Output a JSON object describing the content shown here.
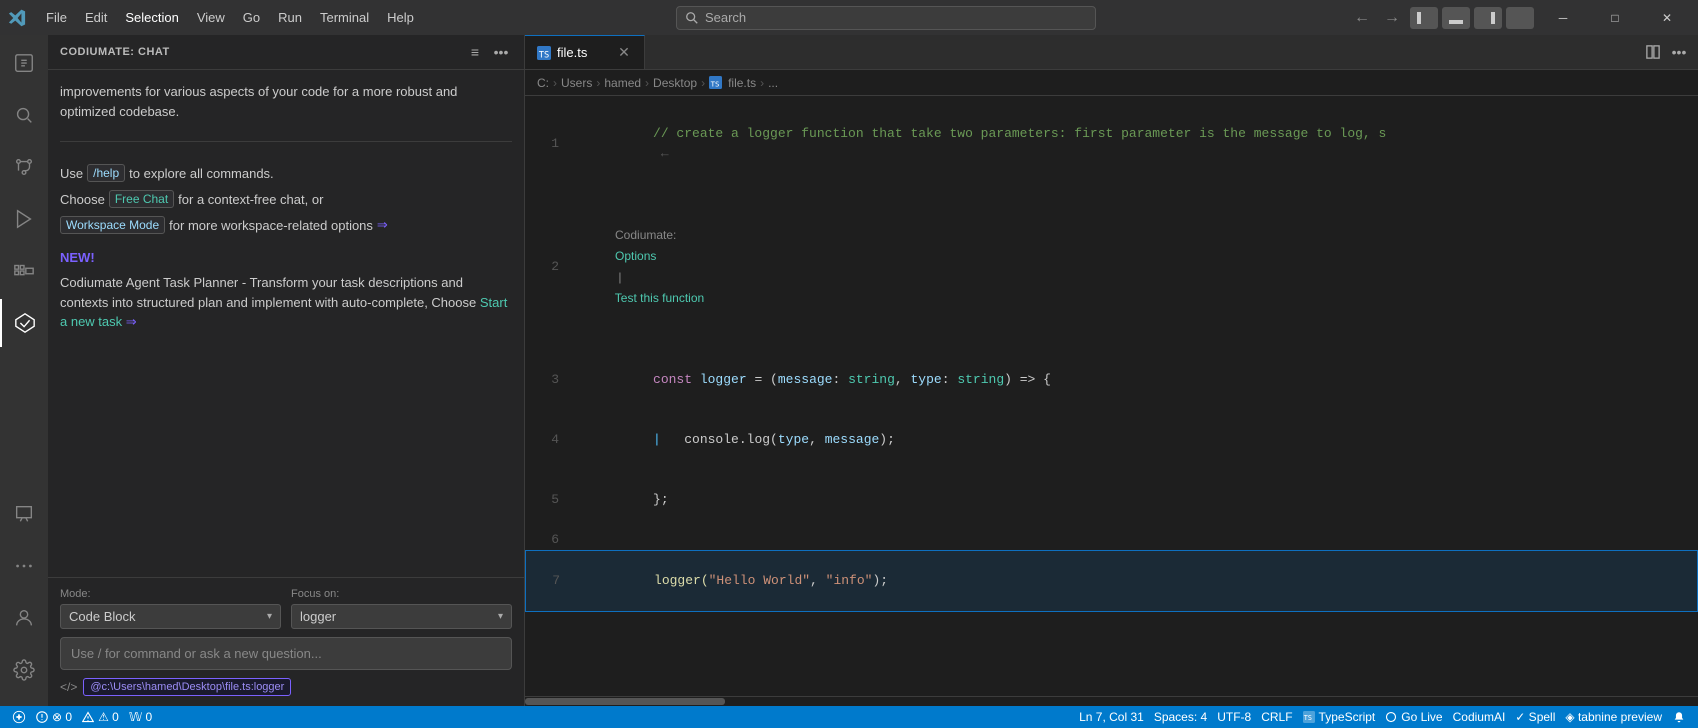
{
  "titlebar": {
    "menu_items": [
      "File",
      "Edit",
      "Selection",
      "View",
      "Go",
      "Run",
      "Terminal",
      "Help"
    ],
    "search_placeholder": "Search",
    "nav_back": "←",
    "nav_forward": "→",
    "win_minimize": "─",
    "win_maximize": "□",
    "win_close": "✕"
  },
  "activity_bar": {
    "icons": [
      {
        "name": "explorer-icon",
        "symbol": "⧉",
        "active": false
      },
      {
        "name": "search-icon",
        "symbol": "🔍",
        "active": false
      },
      {
        "name": "source-control-icon",
        "symbol": "⎇",
        "active": false
      },
      {
        "name": "run-icon",
        "symbol": "▷",
        "active": false
      },
      {
        "name": "extensions-icon",
        "symbol": "⊞",
        "active": false
      },
      {
        "name": "codiumate-icon",
        "symbol": "◈",
        "active": true
      },
      {
        "name": "chat-icon",
        "symbol": "💬",
        "active": false
      },
      {
        "name": "more-icon",
        "symbol": "•••",
        "active": false
      }
    ],
    "bottom_icons": [
      {
        "name": "account-icon",
        "symbol": "👤"
      },
      {
        "name": "settings-icon",
        "symbol": "⚙"
      }
    ]
  },
  "sidebar": {
    "title": "CODIUMATE: CHAT",
    "action_icons": [
      "≡",
      "•••"
    ],
    "chat_messages": [
      {
        "text": "improvements for various aspects of your code for a more robust and optimized codebase."
      }
    ],
    "help_text": "Use",
    "help_command": "/help",
    "help_text2": "to explore all commands.",
    "choose_text": "Choose",
    "free_chat_label": "Free Chat",
    "for_text": "for a context-free chat, or",
    "workspace_mode_label": "Workspace Mode",
    "workspace_text": "for more workspace-related options",
    "arrow": "⇒",
    "new_badge": "NEW!",
    "agent_text": "Codiumate Agent Task Planner - Transform your task descriptions and contexts into structured plan and implement with auto-complete, Choose",
    "start_task_label": "Start a new task",
    "start_arrow": "⇒",
    "mode_label": "Mode:",
    "focus_label": "Focus on:",
    "mode_value": "Code Block",
    "focus_value": "logger",
    "input_placeholder": "Use / for command or ask a new question...",
    "breadcrumb_icon": "</>",
    "breadcrumb_path": "@c:\\Users\\hamed\\Desktop\\file.ts:logger"
  },
  "editor": {
    "tab_name": "file.ts",
    "breadcrumb_parts": [
      "C:",
      "Users",
      "hamed",
      "Desktop",
      "file.ts",
      "..."
    ],
    "codiumate_options": "Codiumate: Options | Test this function",
    "lines": [
      {
        "num": "1",
        "tokens": [
          {
            "text": "// create a logger function that take two parameters: first parameter is the message to log, s",
            "class": "c-comment"
          }
        ]
      },
      {
        "num": "2",
        "tokens": []
      },
      {
        "num": "3",
        "tokens": [
          {
            "text": "const ",
            "class": "c-keyword"
          },
          {
            "text": "logger",
            "class": "c-var"
          },
          {
            "text": " = (",
            "class": "c-punct"
          },
          {
            "text": "message",
            "class": "c-var"
          },
          {
            "text": ": ",
            "class": "c-punct"
          },
          {
            "text": "string",
            "class": "c-type"
          },
          {
            "text": ", ",
            "class": "c-punct"
          },
          {
            "text": "type",
            "class": "c-var"
          },
          {
            "text": ": ",
            "class": "c-punct"
          },
          {
            "text": "string",
            "class": "c-type"
          },
          {
            "text": ") => {",
            "class": "c-punct"
          }
        ]
      },
      {
        "num": "4",
        "tokens": [
          {
            "text": "| ",
            "class": "c-pipe"
          },
          {
            "text": "  console",
            "class": "c-plain"
          },
          {
            "text": ".log(",
            "class": "c-punct"
          },
          {
            "text": "type",
            "class": "c-var"
          },
          {
            "text": ", ",
            "class": "c-punct"
          },
          {
            "text": "message",
            "class": "c-var"
          },
          {
            "text": ");",
            "class": "c-punct"
          }
        ]
      },
      {
        "num": "5",
        "tokens": [
          {
            "text": "};",
            "class": "c-punct"
          }
        ]
      },
      {
        "num": "6",
        "tokens": []
      },
      {
        "num": "7",
        "tokens": [
          {
            "text": "logger(",
            "class": "c-func"
          },
          {
            "text": "\"Hello World\"",
            "class": "c-string"
          },
          {
            "text": ", ",
            "class": "c-punct"
          },
          {
            "text": "\"info\"",
            "class": "c-string"
          },
          {
            "text": ");",
            "class": "c-punct"
          }
        ],
        "selected": true
      }
    ]
  },
  "status_bar": {
    "remote": "⊗ 0",
    "errors": "⊗ 0",
    "warnings": "⚠ 0",
    "info": "𝕎 0",
    "position": "Ln 7, Col 31",
    "spaces": "Spaces: 4",
    "encoding": "UTF-8",
    "eol": "CRLF",
    "language": "TypeScript",
    "go_live": "Go Live",
    "codium_ai": "CodiumAI",
    "spell": "✓ Spell",
    "tabnine": "◈ tabnine preview",
    "notifications": "🔔"
  }
}
